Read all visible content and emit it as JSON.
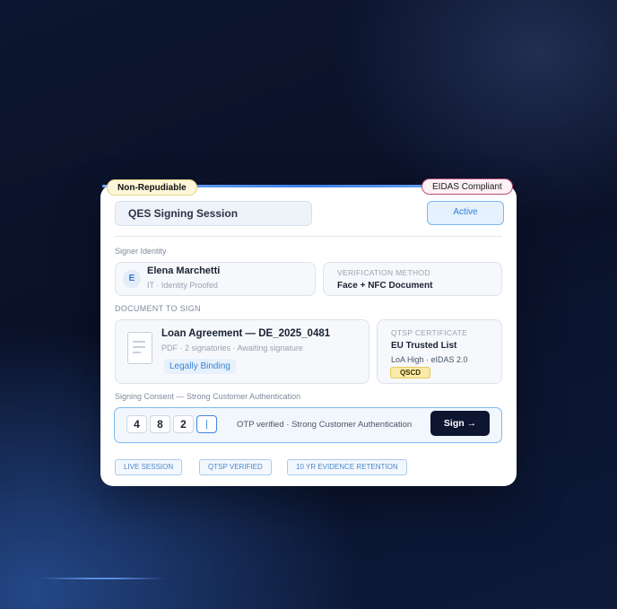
{
  "badges": {
    "left": "Non-Repudiable",
    "right": "EIDAS Compliant"
  },
  "session": {
    "title": "QES Signing Session",
    "status": "Active"
  },
  "signer": {
    "section_label": "Signer Identity",
    "avatar_initial": "E",
    "name": "Elena Marchetti",
    "subtitle": "IT · Identity Proofed",
    "verification_label": "VERIFICATION METHOD",
    "verification_value": "Face + NFC Document"
  },
  "document": {
    "section_label": "DOCUMENT TO SIGN",
    "title": "Loan Agreement — DE_2025_0481",
    "subtitle": "PDF · 2 signatories · Awaiting signature",
    "binding_tag": "Legally Binding"
  },
  "certificate": {
    "label": "QTSP CERTIFICATE",
    "name": "EU Trusted List",
    "level": "LoA High · eIDAS 2.0",
    "device_tag": "QSCD"
  },
  "consent": {
    "section_label": "Signing Consent — Strong Customer Authentication",
    "otp_digits": [
      "4",
      "8",
      "2",
      "|"
    ],
    "status": "OTP verified · Strong Customer Authentication",
    "sign_button": "Sign →"
  },
  "chips": [
    "LIVE SESSION",
    "QTSP VERIFIED",
    "10 YR EVIDENCE RETENTION"
  ],
  "colors": {
    "accent": "#3d86df",
    "dark_button": "#0d1530",
    "qscd": "#fbeaa8"
  }
}
